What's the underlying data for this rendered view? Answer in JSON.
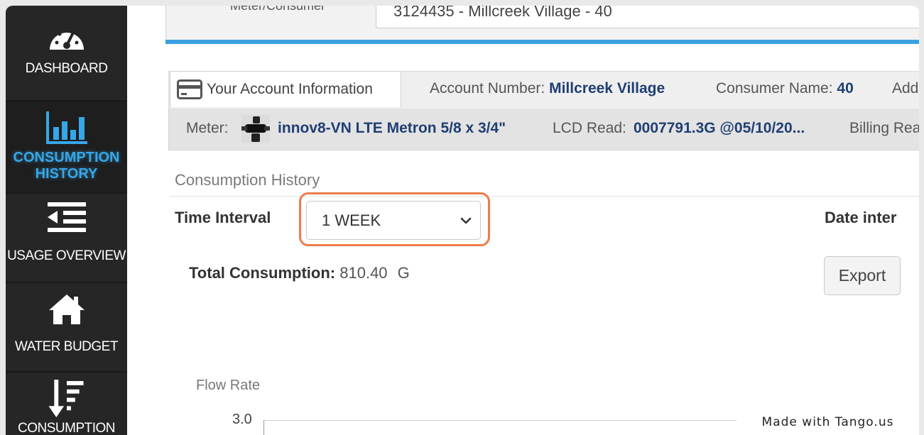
{
  "sidebar": {
    "items": [
      {
        "label": "DASHBOARD",
        "icon": "gauge-icon"
      },
      {
        "label": "CONSUMPTION HISTORY",
        "icon": "bar-chart-icon",
        "active": true
      },
      {
        "label": "USAGE OVERVIEW",
        "icon": "list-indent-icon"
      },
      {
        "label": "WATER BUDGET",
        "icon": "home-icon"
      },
      {
        "label": "CONSUMPTION",
        "icon": "sort-down-icon"
      }
    ]
  },
  "header": {
    "meter_consumer_label": "Meter/Consumer",
    "meter_consumer_value": "3124435 - Millcreek Village - 40"
  },
  "account": {
    "tab_label": "Your Account Information",
    "account_number_label": "Account Number:",
    "account_number_value": "Millcreek Village",
    "consumer_name_label": "Consumer Name:",
    "consumer_name_value": "40",
    "address_label_partial": "Add"
  },
  "meter": {
    "meter_label": "Meter:",
    "meter_value": "innov8-VN LTE Metron 5/8 x 3/4\"",
    "lcd_label": "LCD Read:",
    "lcd_value": "0007791.3G @05/10/20...",
    "billing_label_partial": "Billing Rea"
  },
  "history": {
    "section_title": "Consumption History",
    "time_interval_label": "Time Interval",
    "time_interval_value": "1 WEEK",
    "date_interval_label": "Date inter",
    "total_label": "Total Consumption:",
    "total_value": "810.40",
    "total_unit": "G",
    "export_label": "Export",
    "flow_rate_label": "Flow Rate",
    "y_tick_top": "3.0"
  },
  "watermark": "Made with Tango.us",
  "colors": {
    "sidebar_bg": "#262626",
    "active_nav": "#36a7e6",
    "accent_bar": "#3aa0e2",
    "highlight": "#ee7b4a",
    "value_text": "#1f3f73"
  }
}
